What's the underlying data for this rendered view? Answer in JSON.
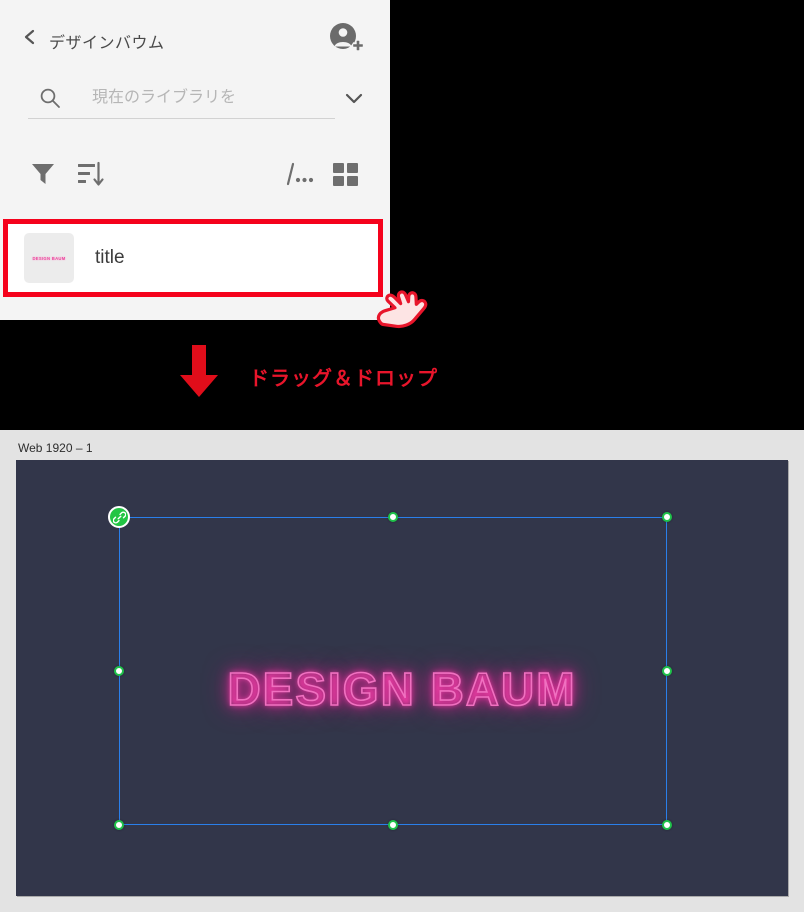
{
  "library_panel": {
    "title": "デザインバウム",
    "back_icon": "chevron-left-icon",
    "avatar_icon": "add-person-icon",
    "search": {
      "icon": "search-icon",
      "value": "",
      "placeholder": "現在のライブラリを",
      "dropdown_icon": "chevron-down-icon"
    },
    "toolbar": {
      "filter_icon": "filter-icon",
      "sort_icon": "sort-descending-icon",
      "list_view_icon": "list-view-icon",
      "grid_view_icon": "grid-view-icon"
    },
    "asset": {
      "thumbnail_text": "DESIGN BAUM",
      "label": "title"
    },
    "colors": {
      "panel_bg": "#f4f4f4",
      "title_text": "#4a4a4a",
      "placeholder": "#b6b6b6"
    }
  },
  "annotation": {
    "highlight_color": "#f5021c",
    "hand_icon": "pointing-hand-cursor-icon",
    "arrow_icon": "arrow-down-icon",
    "label": "ドラッグ＆ドロップ",
    "label_color": "#e8152b"
  },
  "canvas": {
    "artboard_label": "Web 1920 – 1",
    "artboard_bg": "#32364a",
    "canvas_bg": "#e3e3e3",
    "text_layer": "DESIGN BAUM",
    "neon_color": "#f070c0",
    "selection": {
      "border_color": "#2a7fea",
      "handle_fill": "#ffffff",
      "handle_border": "#1fc24a",
      "link_badge_icon": "link-chain-icon",
      "link_badge_color": "#22c544"
    }
  }
}
